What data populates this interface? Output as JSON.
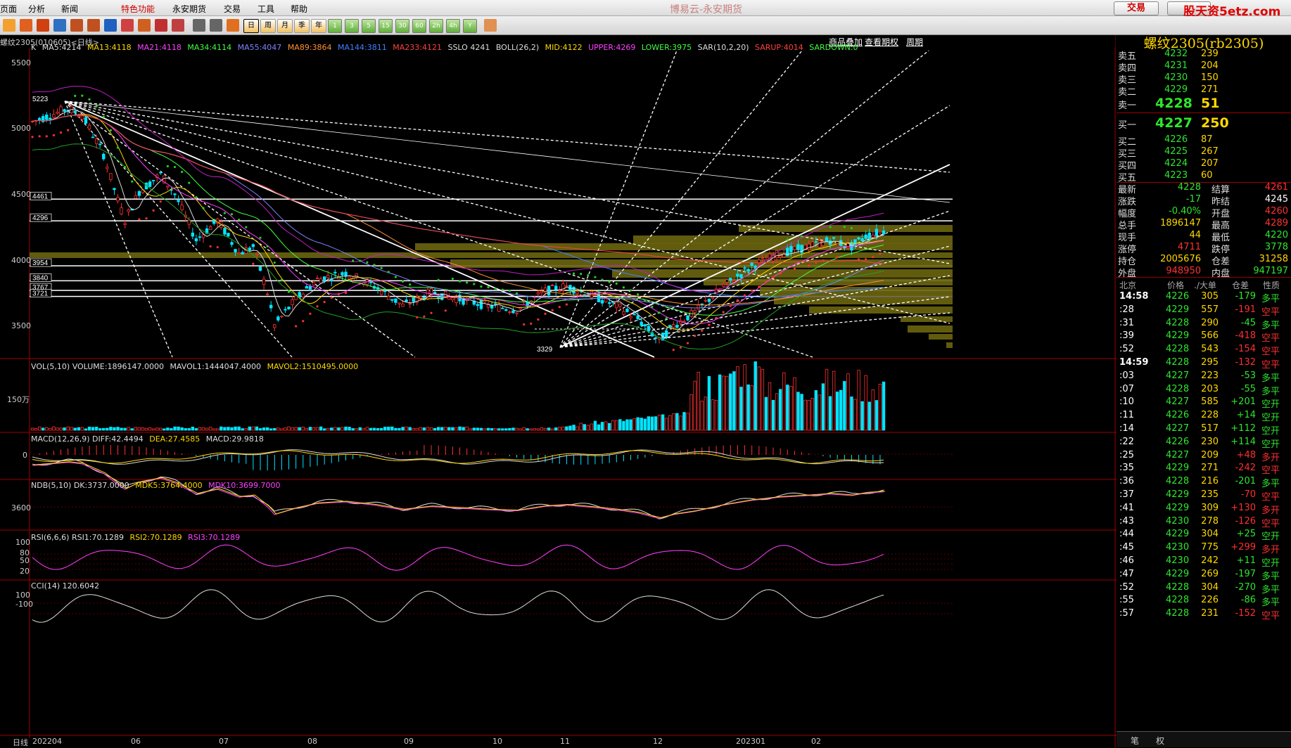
{
  "menubar": {
    "items": [
      "页面",
      "分析",
      "新闻",
      "特色功能",
      "永安期货",
      "交易",
      "工具",
      "帮助"
    ],
    "active_index": 3,
    "title": "博易云-永安期货",
    "trade_button": "交易",
    "watermark": "股天资5etz.com"
  },
  "toolbar": {
    "period_buttons": [
      "日",
      "周",
      "月",
      "季",
      "年"
    ],
    "minute_buttons": [
      "1",
      "3",
      "5",
      "15",
      "30",
      "60",
      "2h",
      "4h",
      "Y"
    ]
  },
  "chart_header": {
    "code": "螺纹2305(010605)<日线>",
    "links": [
      "商品叠加",
      "查看期权",
      "周期"
    ]
  },
  "main_panel": {
    "legend": [
      {
        "text": "K",
        "color": "#dddddd"
      },
      {
        "text": "MA5:4214",
        "color": "#dddddd"
      },
      {
        "text": "MA13:4118",
        "color": "#ffd800"
      },
      {
        "text": "MA21:4118",
        "color": "#ff40ff"
      },
      {
        "text": "MA34:4114",
        "color": "#40ff40"
      },
      {
        "text": "MA55:4047",
        "color": "#8080ff"
      },
      {
        "text": "MA89:3864",
        "color": "#ff9030"
      },
      {
        "text": "MA144:3811",
        "color": "#4080ff"
      },
      {
        "text": "MA233:4121",
        "color": "#ff4040"
      },
      {
        "text": "SSLO 4241",
        "color": "#dddddd"
      },
      {
        "text": "BOLL(26,2)",
        "color": "#dddddd"
      },
      {
        "text": "MID:4122",
        "color": "#ffd800"
      },
      {
        "text": "UPPER:4269",
        "color": "#ff40ff"
      },
      {
        "text": "LOWER:3975",
        "color": "#40ff40"
      },
      {
        "text": "SAR(10,2,20)",
        "color": "#dddddd"
      },
      {
        "text": "SARUP:4014",
        "color": "#ff4040"
      },
      {
        "text": "SARDOWN:0",
        "color": "#40ff40"
      }
    ],
    "y_ticks": [
      "5500",
      "5000",
      "4500",
      "4000",
      "3500"
    ],
    "price_levels": [
      "4461",
      "4296",
      "3954",
      "3840",
      "3767",
      "3721"
    ],
    "annotations": {
      "high": "5223",
      "low": "3329"
    }
  },
  "vol_panel": {
    "legend": [
      {
        "text": "VOL(5,10) VOLUME:1896147.0000",
        "color": "#dddddd"
      },
      {
        "text": "MAVOL1:1444047.4000",
        "color": "#dddddd"
      },
      {
        "text": "MAVOL2:1510495.0000",
        "color": "#ffd800"
      }
    ],
    "y_label": "150万"
  },
  "macd_panel": {
    "legend": [
      {
        "text": "MACD(12,26,9) DIFF:42.4494",
        "color": "#dddddd"
      },
      {
        "text": "DEA:27.4585",
        "color": "#ffd800"
      },
      {
        "text": "MACD:29.9818",
        "color": "#dddddd"
      }
    ],
    "y_label": "0"
  },
  "ndb_panel": {
    "legend": [
      {
        "text": "NDB(5,10) DK:3737.0000",
        "color": "#dddddd"
      },
      {
        "text": "MDK5:3764.4000",
        "color": "#ffd800"
      },
      {
        "text": "MDK10:3699.7000",
        "color": "#ff40ff"
      }
    ],
    "y_label": "3600"
  },
  "rsi_panel": {
    "legend": [
      {
        "text": "RSI(6,6,6) RSI1:70.1289",
        "color": "#dddddd"
      },
      {
        "text": "RSI2:70.1289",
        "color": "#ffd800"
      },
      {
        "text": "RSI3:70.1289",
        "color": "#ff40ff"
      }
    ],
    "y_labels": [
      "100",
      "80",
      "50",
      "20"
    ]
  },
  "cci_panel": {
    "legend": [
      {
        "text": "CCI(14) 120.6042",
        "color": "#dddddd"
      }
    ],
    "y_labels": [
      "100",
      "-100"
    ]
  },
  "x_axis": {
    "label": "日线",
    "ticks": [
      "202204",
      "06",
      "07",
      "08",
      "09",
      "10",
      "11",
      "12",
      "202301",
      "02"
    ]
  },
  "quote_panel": {
    "title": "螺纹2305(rb2305)",
    "asks": [
      {
        "label": "卖五",
        "price": "4232",
        "vol": "239"
      },
      {
        "label": "卖四",
        "price": "4231",
        "vol": "204"
      },
      {
        "label": "卖三",
        "price": "4230",
        "vol": "150"
      },
      {
        "label": "卖二",
        "price": "4229",
        "vol": "271"
      },
      {
        "label": "卖一",
        "price": "4228",
        "vol": "51"
      }
    ],
    "bids": [
      {
        "label": "买一",
        "price": "4227",
        "vol": "250"
      },
      {
        "label": "买二",
        "price": "4226",
        "vol": "87"
      },
      {
        "label": "买三",
        "price": "4225",
        "vol": "267"
      },
      {
        "label": "买四",
        "price": "4224",
        "vol": "207"
      },
      {
        "label": "买五",
        "price": "4223",
        "vol": "60"
      }
    ],
    "stats": [
      {
        "l1": "最新",
        "v1": "4228",
        "c1": "grn",
        "l2": "结算",
        "v2": "4261",
        "c2": "red"
      },
      {
        "l1": "涨跌",
        "v1": "-17",
        "c1": "grn",
        "l2": "昨结",
        "v2": "4245",
        "c2": "wht"
      },
      {
        "l1": "幅度",
        "v1": "-0.40%",
        "c1": "grn",
        "l2": "开盘",
        "v2": "4260",
        "c2": "red"
      },
      {
        "l1": "总手",
        "v1": "1896147",
        "c1": "yel",
        "l2": "最高",
        "v2": "4289",
        "c2": "red"
      },
      {
        "l1": "现手",
        "v1": "44",
        "c1": "yel",
        "l2": "最低",
        "v2": "4220",
        "c2": "grn"
      },
      {
        "l1": "涨停",
        "v1": "4711",
        "c1": "red",
        "l2": "跌停",
        "v2": "3778",
        "c2": "grn"
      },
      {
        "l1": "持仓",
        "v1": "2005676",
        "c1": "yel",
        "l2": "仓差",
        "v2": "31258",
        "c2": "yel"
      },
      {
        "l1": "外盘",
        "v1": "948950",
        "c1": "red",
        "l2": "内盘",
        "v2": "947197",
        "c2": "grn"
      }
    ],
    "tick_header": [
      "北京",
      "价格",
      "./大单",
      "仓差",
      "性质"
    ],
    "ticks": [
      {
        "time": "14:58",
        "price": "4226",
        "vol": "305",
        "oi": "-179",
        "oi_c": "grn",
        "nature": "多平",
        "nat_c": "grn",
        "bold": true
      },
      {
        "time": ":28",
        "price": "4229",
        "vol": "557",
        "oi": "-191",
        "oi_c": "red",
        "nature": "空平",
        "nat_c": "red"
      },
      {
        "time": ":31",
        "price": "4228",
        "vol": "290",
        "oi": "-45",
        "oi_c": "grn",
        "nature": "多平",
        "nat_c": "grn"
      },
      {
        "time": ":39",
        "price": "4229",
        "vol": "566",
        "oi": "-418",
        "oi_c": "red",
        "nature": "空平",
        "nat_c": "red"
      },
      {
        "time": ":52",
        "price": "4228",
        "vol": "543",
        "oi": "-154",
        "oi_c": "red",
        "nature": "空平",
        "nat_c": "red"
      },
      {
        "time": "14:59",
        "price": "4228",
        "vol": "295",
        "oi": "-132",
        "oi_c": "red",
        "nature": "空平",
        "nat_c": "red",
        "bold": true
      },
      {
        "time": ":03",
        "price": "4227",
        "vol": "223",
        "oi": "-53",
        "oi_c": "grn",
        "nature": "多平",
        "nat_c": "grn"
      },
      {
        "time": ":07",
        "price": "4228",
        "vol": "203",
        "oi": "-55",
        "oi_c": "grn",
        "nature": "多平",
        "nat_c": "grn"
      },
      {
        "time": ":10",
        "price": "4227",
        "vol": "585",
        "oi": "+201",
        "oi_c": "grn",
        "nature": "空开",
        "nat_c": "grn"
      },
      {
        "time": ":11",
        "price": "4226",
        "vol": "228",
        "oi": "+14",
        "oi_c": "grn",
        "nature": "空开",
        "nat_c": "grn"
      },
      {
        "time": ":14",
        "price": "4227",
        "vol": "517",
        "oi": "+112",
        "oi_c": "grn",
        "nature": "空开",
        "nat_c": "grn"
      },
      {
        "time": ":22",
        "price": "4226",
        "vol": "230",
        "oi": "+114",
        "oi_c": "grn",
        "nature": "空开",
        "nat_c": "grn"
      },
      {
        "time": ":25",
        "price": "4227",
        "vol": "209",
        "oi": "+48",
        "oi_c": "red",
        "nature": "多开",
        "nat_c": "red"
      },
      {
        "time": ":35",
        "price": "4229",
        "vol": "271",
        "oi": "-242",
        "oi_c": "red",
        "nature": "空平",
        "nat_c": "red"
      },
      {
        "time": ":36",
        "price": "4228",
        "vol": "216",
        "oi": "-201",
        "oi_c": "grn",
        "nature": "多平",
        "nat_c": "grn"
      },
      {
        "time": ":37",
        "price": "4229",
        "vol": "235",
        "oi": "-70",
        "oi_c": "red",
        "nature": "空平",
        "nat_c": "red"
      },
      {
        "time": ":41",
        "price": "4229",
        "vol": "309",
        "oi": "+130",
        "oi_c": "red",
        "nature": "多开",
        "nat_c": "red"
      },
      {
        "time": ":43",
        "price": "4230",
        "vol": "278",
        "oi": "-126",
        "oi_c": "red",
        "nature": "空平",
        "nat_c": "red"
      },
      {
        "time": ":44",
        "price": "4229",
        "vol": "304",
        "oi": "+25",
        "oi_c": "grn",
        "nature": "空开",
        "nat_c": "grn"
      },
      {
        "time": ":45",
        "price": "4230",
        "vol": "775",
        "oi": "+299",
        "oi_c": "red",
        "nature": "多开",
        "nat_c": "red"
      },
      {
        "time": ":46",
        "price": "4230",
        "vol": "242",
        "oi": "+11",
        "oi_c": "grn",
        "nature": "空开",
        "nat_c": "grn"
      },
      {
        "time": ":47",
        "price": "4229",
        "vol": "269",
        "oi": "-197",
        "oi_c": "grn",
        "nature": "多平",
        "nat_c": "grn"
      },
      {
        "time": ":52",
        "price": "4228",
        "vol": "304",
        "oi": "-270",
        "oi_c": "grn",
        "nature": "多平",
        "nat_c": "grn"
      },
      {
        "time": ":55",
        "price": "4228",
        "vol": "226",
        "oi": "-86",
        "oi_c": "grn",
        "nature": "多平",
        "nat_c": "grn"
      },
      {
        "time": ":57",
        "price": "4228",
        "vol": "231",
        "oi": "-152",
        "oi_c": "red",
        "nature": "空平",
        "nat_c": "red"
      }
    ],
    "bottom_tabs": [
      "笔",
      "权"
    ]
  },
  "colors": {
    "up": "#ff3030",
    "down": "#00e5ff",
    "ask_bid_big": "#2ee62e",
    "title": "#ffd800",
    "volume_profile": "#6b6510"
  }
}
